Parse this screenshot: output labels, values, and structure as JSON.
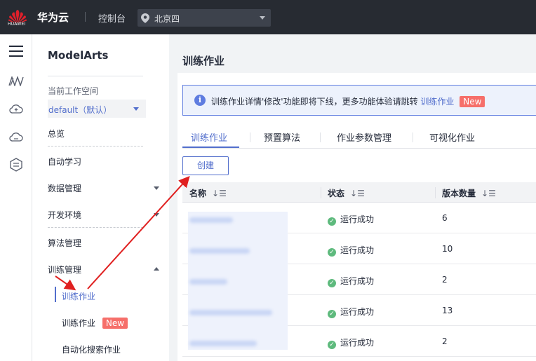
{
  "topbar": {
    "logo_text": "HUAWEI",
    "brand": "华为云",
    "console": "控制台",
    "region": "北京四"
  },
  "rail": {
    "icons": [
      "menu-icon",
      "modelarts-icon",
      "cloud-upload-icon",
      "cloud-icon",
      "hexagon-icon"
    ]
  },
  "nav": {
    "title": "ModelArts",
    "workspace_label": "当前工作空间",
    "workspace_value": "default（默认）",
    "items": {
      "overview": "总览",
      "auto_learning": "自动学习",
      "data_mgmt": "数据管理",
      "dev_env": "开发环境",
      "algo_mgmt": "算法管理",
      "training_mgmt": "训练管理"
    },
    "sub_items": {
      "training_job": "训练作业",
      "training_job_new": "训练作业",
      "new_badge": "New",
      "auto_search": "自动化搜索作业"
    }
  },
  "main": {
    "title": "训练作业",
    "notice": {
      "text": "训练作业详情'修改'功能即将下线，更多功能体验请跳转 ",
      "link": "训练作业",
      "badge": "New"
    },
    "tabs": [
      "训练作业",
      "预置算法",
      "作业参数管理",
      "可视化作业"
    ],
    "create_button": "创建",
    "table": {
      "headers": {
        "name": "名称",
        "status": "状态",
        "versions": "版本数量"
      },
      "rows": [
        {
          "status": "运行成功",
          "versions": "6"
        },
        {
          "status": "运行成功",
          "versions": "10"
        },
        {
          "status": "运行成功",
          "versions": "2"
        },
        {
          "status": "运行成功",
          "versions": "13"
        },
        {
          "status": "运行成功",
          "versions": "2"
        }
      ]
    }
  },
  "colors": {
    "topbar": "#272b32",
    "accent": "#526ecc",
    "new_badge": "#f66f6a",
    "success": "#5eba7d",
    "annotation_arrow": "#e02020"
  }
}
